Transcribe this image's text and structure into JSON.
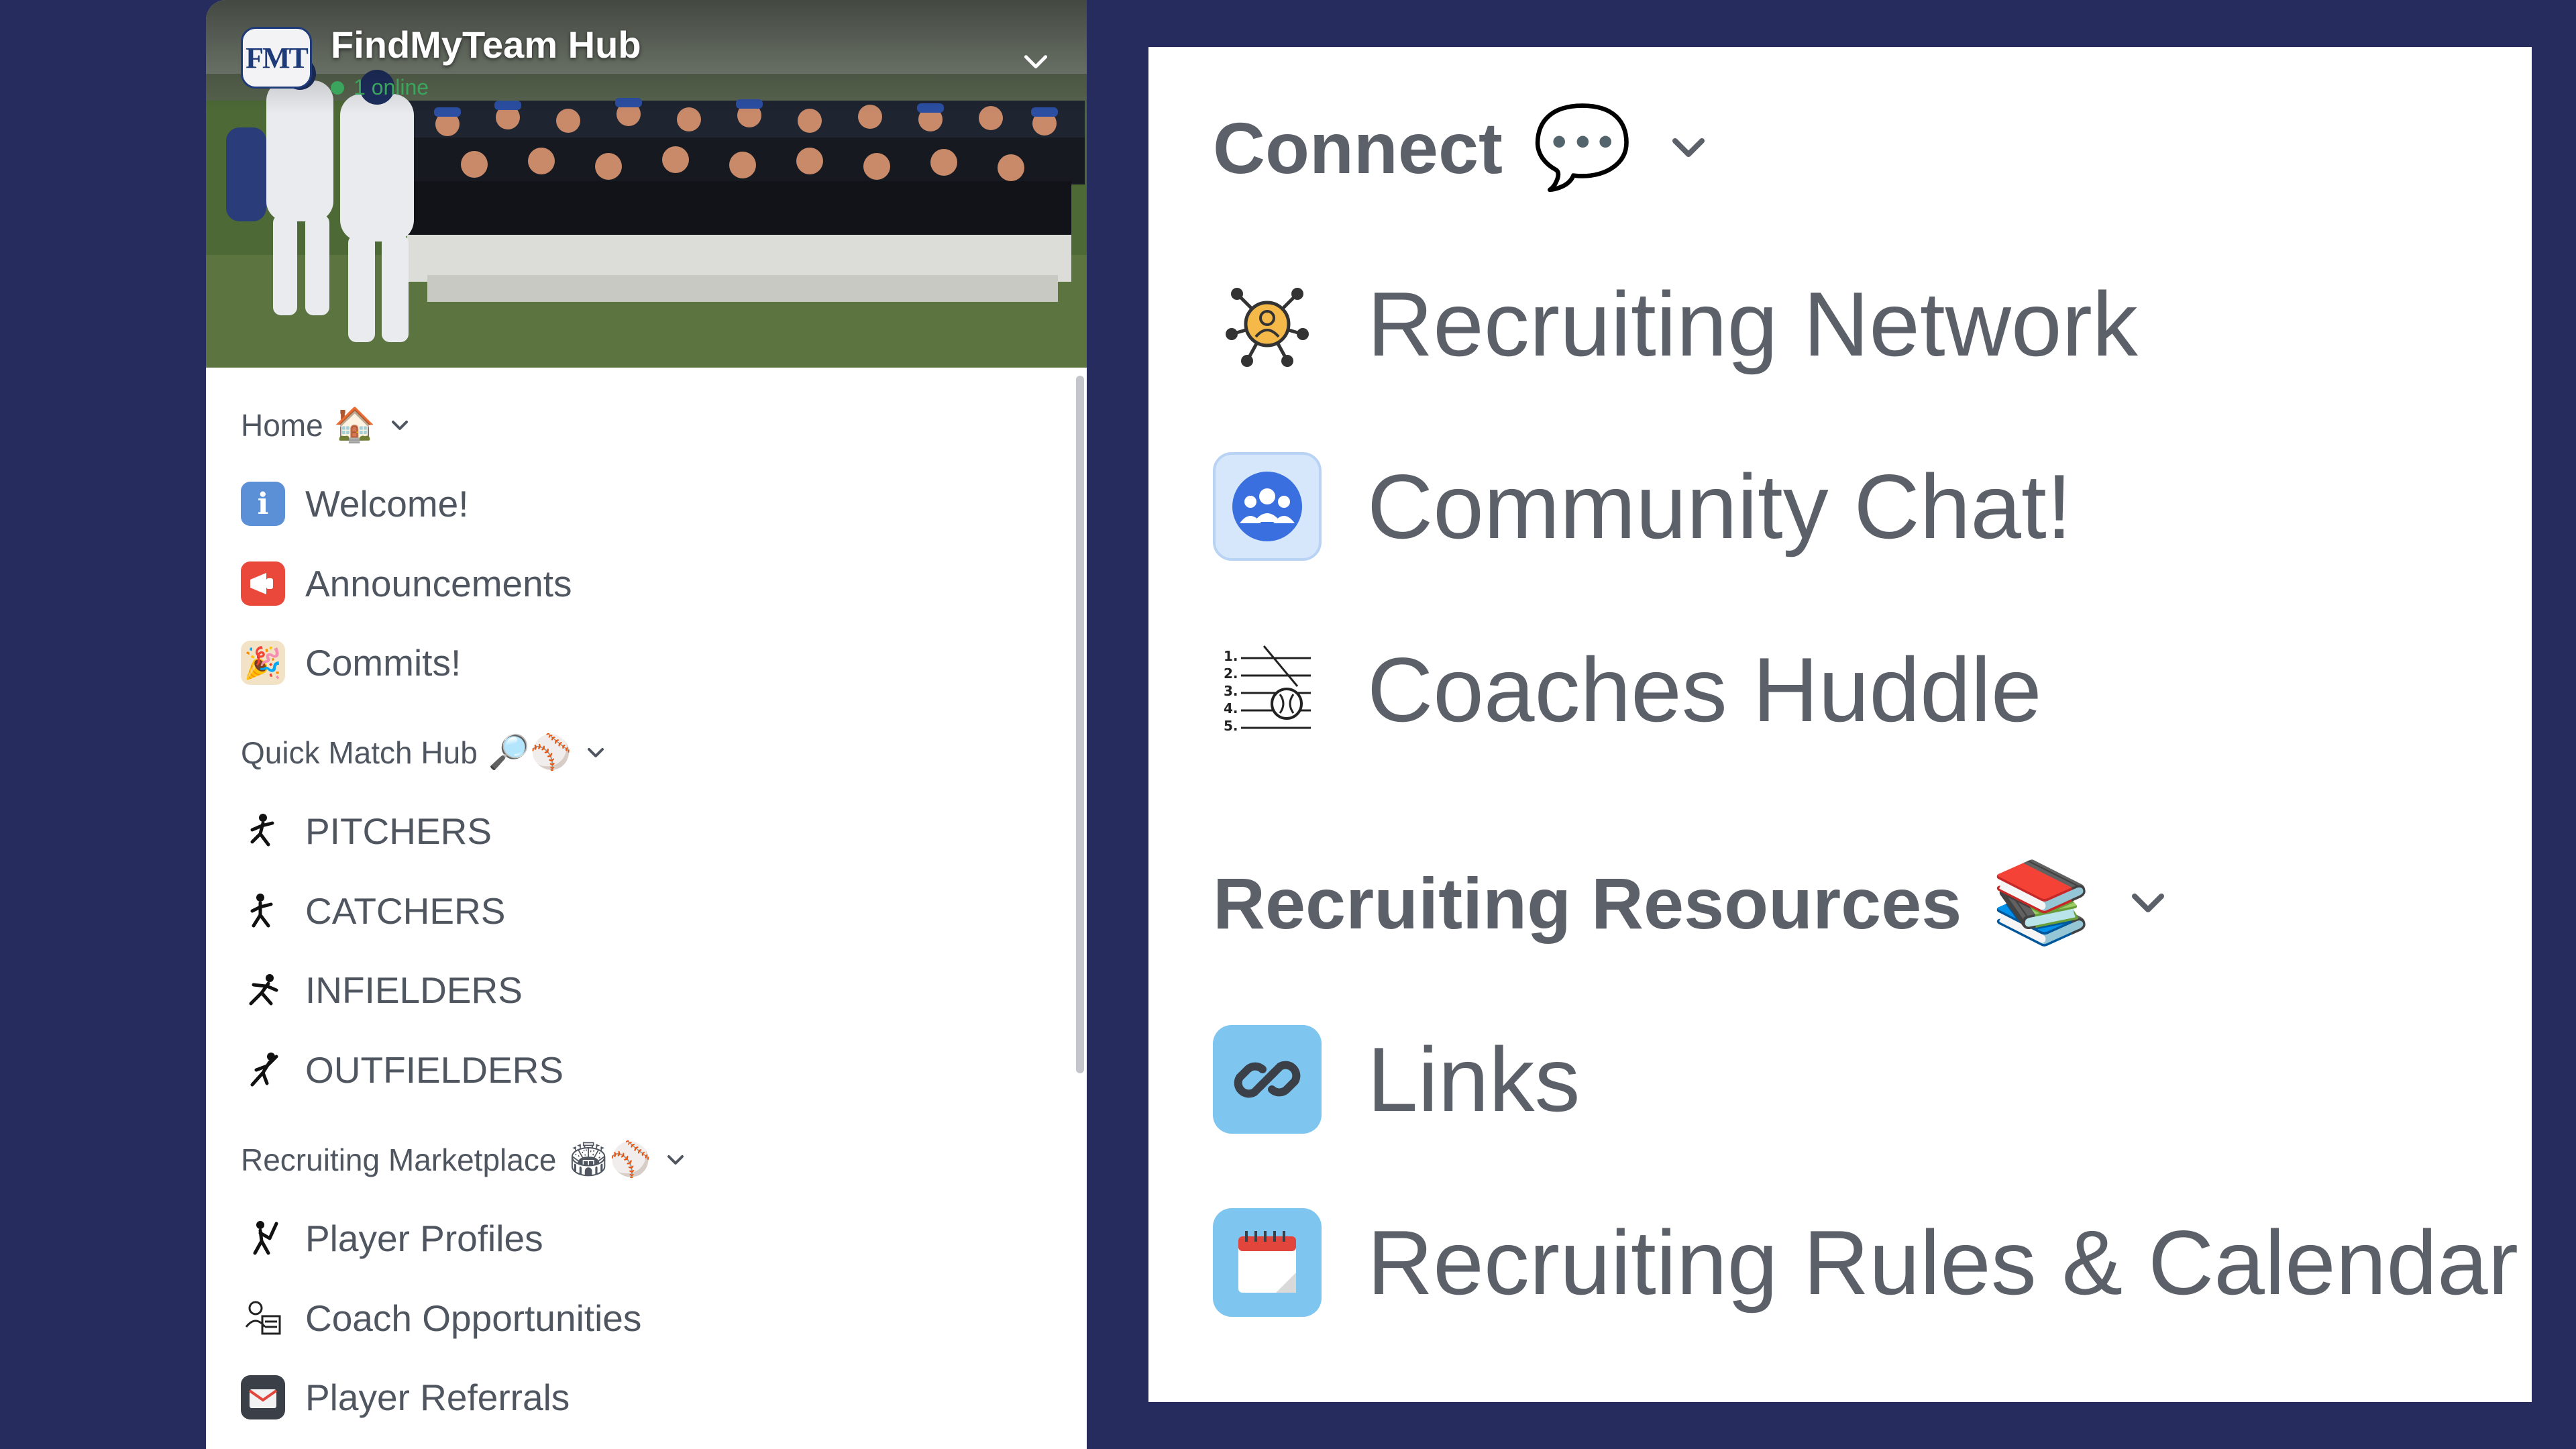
{
  "server": {
    "name": "FindMyTeam Hub",
    "logo_text": "FMT",
    "online_text": "1 online"
  },
  "left": {
    "categories": [
      {
        "label": "Home",
        "emoji": "🏠",
        "channels": [
          {
            "label": "Welcome!",
            "icon": "info-icon",
            "glyph": "i"
          },
          {
            "label": "Announcements",
            "icon": "megaphone-icon",
            "glyph": "📢"
          },
          {
            "label": "Commits!",
            "icon": "party-icon",
            "glyph": "🎉"
          }
        ]
      },
      {
        "label": "Quick Match Hub",
        "emoji": "🔎⚾",
        "channels": [
          {
            "label": "PITCHERS",
            "icon": "pitcher-icon",
            "glyph": "🏃"
          },
          {
            "label": "CATCHERS",
            "icon": "catcher-icon",
            "glyph": "🏃"
          },
          {
            "label": "INFIELDERS",
            "icon": "infielder-icon",
            "glyph": "🏃"
          },
          {
            "label": "OUTFIELDERS",
            "icon": "outfielder-icon",
            "glyph": "🏃"
          }
        ]
      },
      {
        "label": "Recruiting Marketplace",
        "emoji": "🏟⚾",
        "channels": [
          {
            "label": "Player Profiles",
            "icon": "batter-icon",
            "glyph": "🏃"
          },
          {
            "label": "Coach Opportunities",
            "icon": "coach-icon",
            "glyph": "👤"
          },
          {
            "label": "Player Referrals",
            "icon": "mail-icon",
            "glyph": "✉"
          }
        ]
      }
    ]
  },
  "right": {
    "categories": [
      {
        "label": "Connect",
        "emoji": "💬",
        "channels": [
          {
            "label": "Recruiting Network",
            "icon": "network-icon"
          },
          {
            "label": "Community Chat!",
            "icon": "community-chat-icon"
          },
          {
            "label": "Coaches Huddle",
            "icon": "playbook-icon"
          }
        ]
      },
      {
        "label": "Recruiting Resources",
        "emoji": "📚",
        "channels": [
          {
            "label": "Links",
            "icon": "link-icon"
          },
          {
            "label": "Recruiting Rules & Calendar",
            "icon": "calendar-icon"
          }
        ]
      }
    ]
  },
  "colors": {
    "background": "#262c5e",
    "panel": "#ffffff",
    "text": "#4f5660",
    "online": "#3ba55d"
  }
}
